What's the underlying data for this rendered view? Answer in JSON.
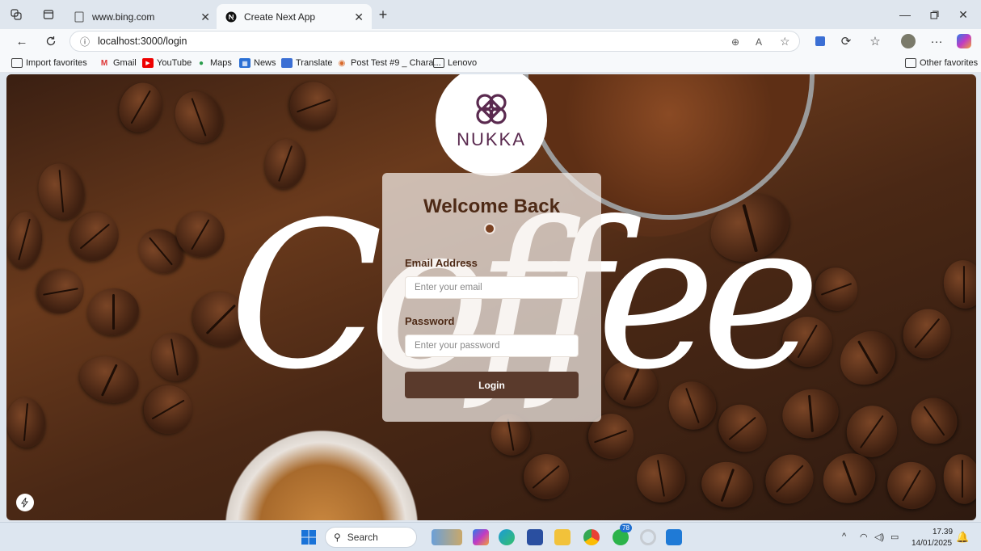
{
  "browser": {
    "tabs": [
      {
        "title": "www.bing.com",
        "active": false
      },
      {
        "title": "Create Next App",
        "active": true
      }
    ],
    "url": "localhost:3000/login",
    "bookmarks": [
      "Import favorites",
      "Gmail",
      "YouTube",
      "Maps",
      "News",
      "Translate",
      "Post Test #9 _ Chara...",
      "Lenovo"
    ],
    "other_favorites": "Other favorites"
  },
  "page": {
    "logo_text": "NUKKA",
    "background_word": "Coffee",
    "login": {
      "title": "Welcome Back",
      "email_label": "Email Address",
      "email_placeholder": "Enter your email",
      "password_label": "Password",
      "password_placeholder": "Enter your password",
      "button": "Login"
    }
  },
  "taskbar": {
    "search_placeholder": "Search",
    "badge": "78",
    "time": "17.39",
    "date": "14/01/2025"
  },
  "colors": {
    "accent_brown": "#5a3a2c",
    "heading_brown": "#4e2a16",
    "logo_purple": "#5a2a4f"
  }
}
